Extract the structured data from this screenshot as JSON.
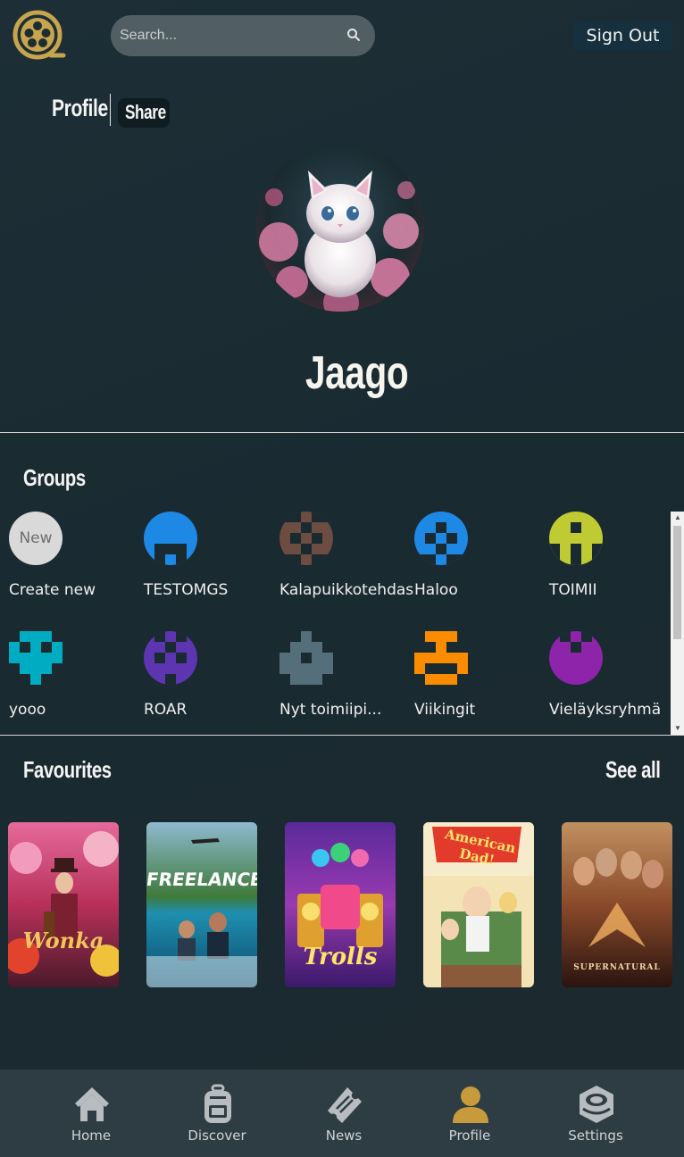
{
  "header": {
    "search_placeholder": "Search...",
    "sign_out_label": "Sign Out"
  },
  "profile": {
    "tab_profile": "Profile",
    "tab_share": "Share",
    "username": "Jaago"
  },
  "groups": {
    "title": "Groups",
    "new_badge": "New",
    "items": [
      {
        "label": "Create new",
        "icon": "new-circle"
      },
      {
        "label": "TESTOMGS",
        "icon": "identicon",
        "color": "#1e88e5"
      },
      {
        "label": "Kalapuikkotehdas",
        "icon": "identicon",
        "color": "#6d4c41"
      },
      {
        "label": "Haloo",
        "icon": "identicon",
        "color": "#1e88e5"
      },
      {
        "label": "TOIMII",
        "icon": "identicon",
        "color": "#c0ca33"
      },
      {
        "label": "yooo",
        "icon": "identicon",
        "color": "#00acc1"
      },
      {
        "label": "ROAR",
        "icon": "identicon",
        "color": "#5e35b1"
      },
      {
        "label": "Nyt toimiipi...",
        "icon": "identicon",
        "color": "#546e7a"
      },
      {
        "label": "Viikingit",
        "icon": "identicon",
        "color": "#fb8c00"
      },
      {
        "label": "Vieläyksryhmä",
        "icon": "identicon",
        "color": "#8e24aa"
      }
    ]
  },
  "favourites": {
    "title": "Favourites",
    "see_all": "See all",
    "posters": [
      "Wonka",
      "FREELANCE",
      "Trolls",
      "American Dad!",
      "SUPERNATURAL"
    ]
  },
  "nav": {
    "items": [
      {
        "label": "Home",
        "icon": "home-icon"
      },
      {
        "label": "Discover",
        "icon": "backpack-icon"
      },
      {
        "label": "News",
        "icon": "ticket-icon"
      },
      {
        "label": "Profile",
        "icon": "user-icon"
      },
      {
        "label": "Settings",
        "icon": "settings-icon"
      }
    ],
    "active_color": "#c79b3c"
  }
}
